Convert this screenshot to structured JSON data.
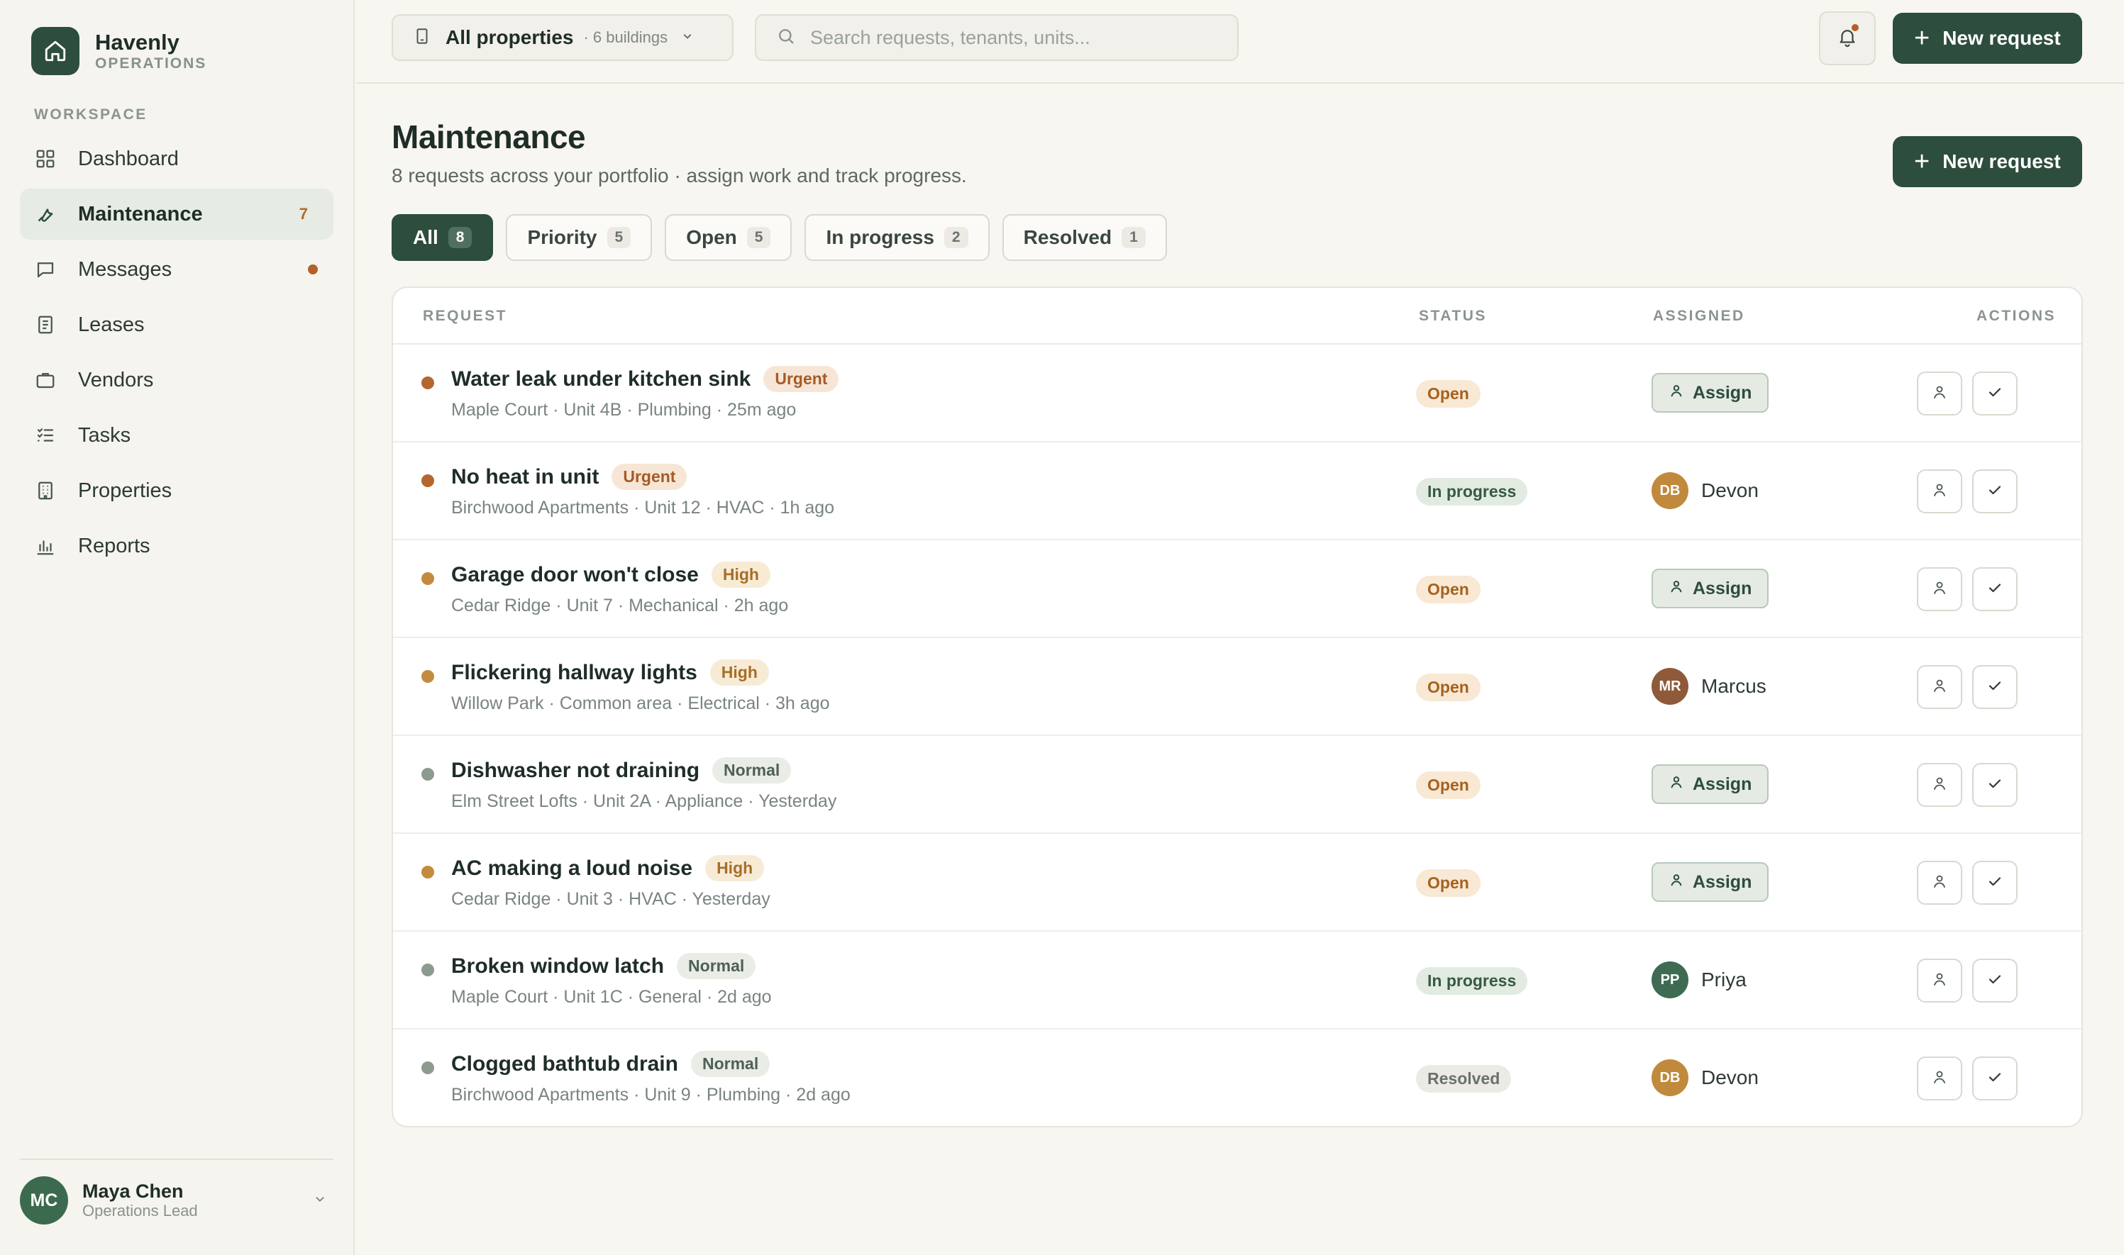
{
  "brand": {
    "name": "Havenly",
    "sub": "OPERATIONS"
  },
  "sidebar": {
    "section_label": "WORKSPACE",
    "items": [
      {
        "label": "Dashboard",
        "icon": "grid-icon"
      },
      {
        "label": "Maintenance",
        "icon": "wrench-icon",
        "active": true,
        "count": "7"
      },
      {
        "label": "Messages",
        "icon": "chat-icon",
        "dot": true
      },
      {
        "label": "Leases",
        "icon": "document-icon"
      },
      {
        "label": "Vendors",
        "icon": "briefcase-icon"
      },
      {
        "label": "Tasks",
        "icon": "checklist-icon"
      },
      {
        "label": "Properties",
        "icon": "building-icon"
      },
      {
        "label": "Reports",
        "icon": "bar-chart-icon"
      }
    ],
    "user": {
      "initials": "MC",
      "name": "Maya Chen",
      "role": "Operations Lead"
    }
  },
  "topbar": {
    "property_select": {
      "label": "All properties",
      "sub": "· 6 buildings"
    },
    "search_placeholder": "Search requests, tenants, units...",
    "new_request_label": "New request"
  },
  "page": {
    "title": "Maintenance",
    "subtitle": "8 requests across your portfolio · assign work and track progress.",
    "new_request_label": "New request"
  },
  "tabs": [
    {
      "label": "All",
      "count": "8",
      "active": true
    },
    {
      "label": "Priority",
      "count": "5"
    },
    {
      "label": "Open",
      "count": "5"
    },
    {
      "label": "In progress",
      "count": "2"
    },
    {
      "label": "Resolved",
      "count": "1"
    }
  ],
  "table": {
    "headers": {
      "request": "REQUEST",
      "status": "STATUS",
      "assigned": "ASSIGNED",
      "actions": "ACTIONS"
    },
    "assign_label": "Assign",
    "rows": [
      {
        "title": "Water leak under kitchen sink",
        "priority": "Urgent",
        "meta": "Maple Court · Unit 4B · Plumbing · 25m ago",
        "status": "Open",
        "assignee": null
      },
      {
        "title": "No heat in unit",
        "priority": "Urgent",
        "meta": "Birchwood Apartments · Unit 12 · HVAC · 1h ago",
        "status": "In progress",
        "assignee": {
          "initials": "DB",
          "name": "Devon",
          "color": "#c0893c"
        }
      },
      {
        "title": "Garage door won't close",
        "priority": "High",
        "meta": "Cedar Ridge · Unit 7 · Mechanical · 2h ago",
        "status": "Open",
        "assignee": null
      },
      {
        "title": "Flickering hallway lights",
        "priority": "High",
        "meta": "Willow Park · Common area · Electrical · 3h ago",
        "status": "Open",
        "assignee": {
          "initials": "MR",
          "name": "Marcus",
          "color": "#8e5a39"
        }
      },
      {
        "title": "Dishwasher not draining",
        "priority": "Normal",
        "meta": "Elm Street Lofts · Unit 2A · Appliance · Yesterday",
        "status": "Open",
        "assignee": null
      },
      {
        "title": "AC making a loud noise",
        "priority": "High",
        "meta": "Cedar Ridge · Unit 3 · HVAC · Yesterday",
        "status": "Open",
        "assignee": null
      },
      {
        "title": "Broken window latch",
        "priority": "Normal",
        "meta": "Maple Court · Unit 1C · General · 2d ago",
        "status": "In progress",
        "assignee": {
          "initials": "PP",
          "name": "Priya",
          "color": "#3e6b52"
        }
      },
      {
        "title": "Clogged bathtub drain",
        "priority": "Normal",
        "meta": "Birchwood Apartments · Unit 9 · Plumbing · 2d ago",
        "status": "Resolved",
        "assignee": {
          "initials": "DB",
          "name": "Devon",
          "color": "#c0893c"
        }
      }
    ]
  },
  "colors": {
    "brand_green": "#2d4d3d",
    "urgent_dot": "#b5652e",
    "high_dot": "#c48a3e",
    "normal_dot": "#8d9a90",
    "alert_dot": "#b55f2a"
  }
}
